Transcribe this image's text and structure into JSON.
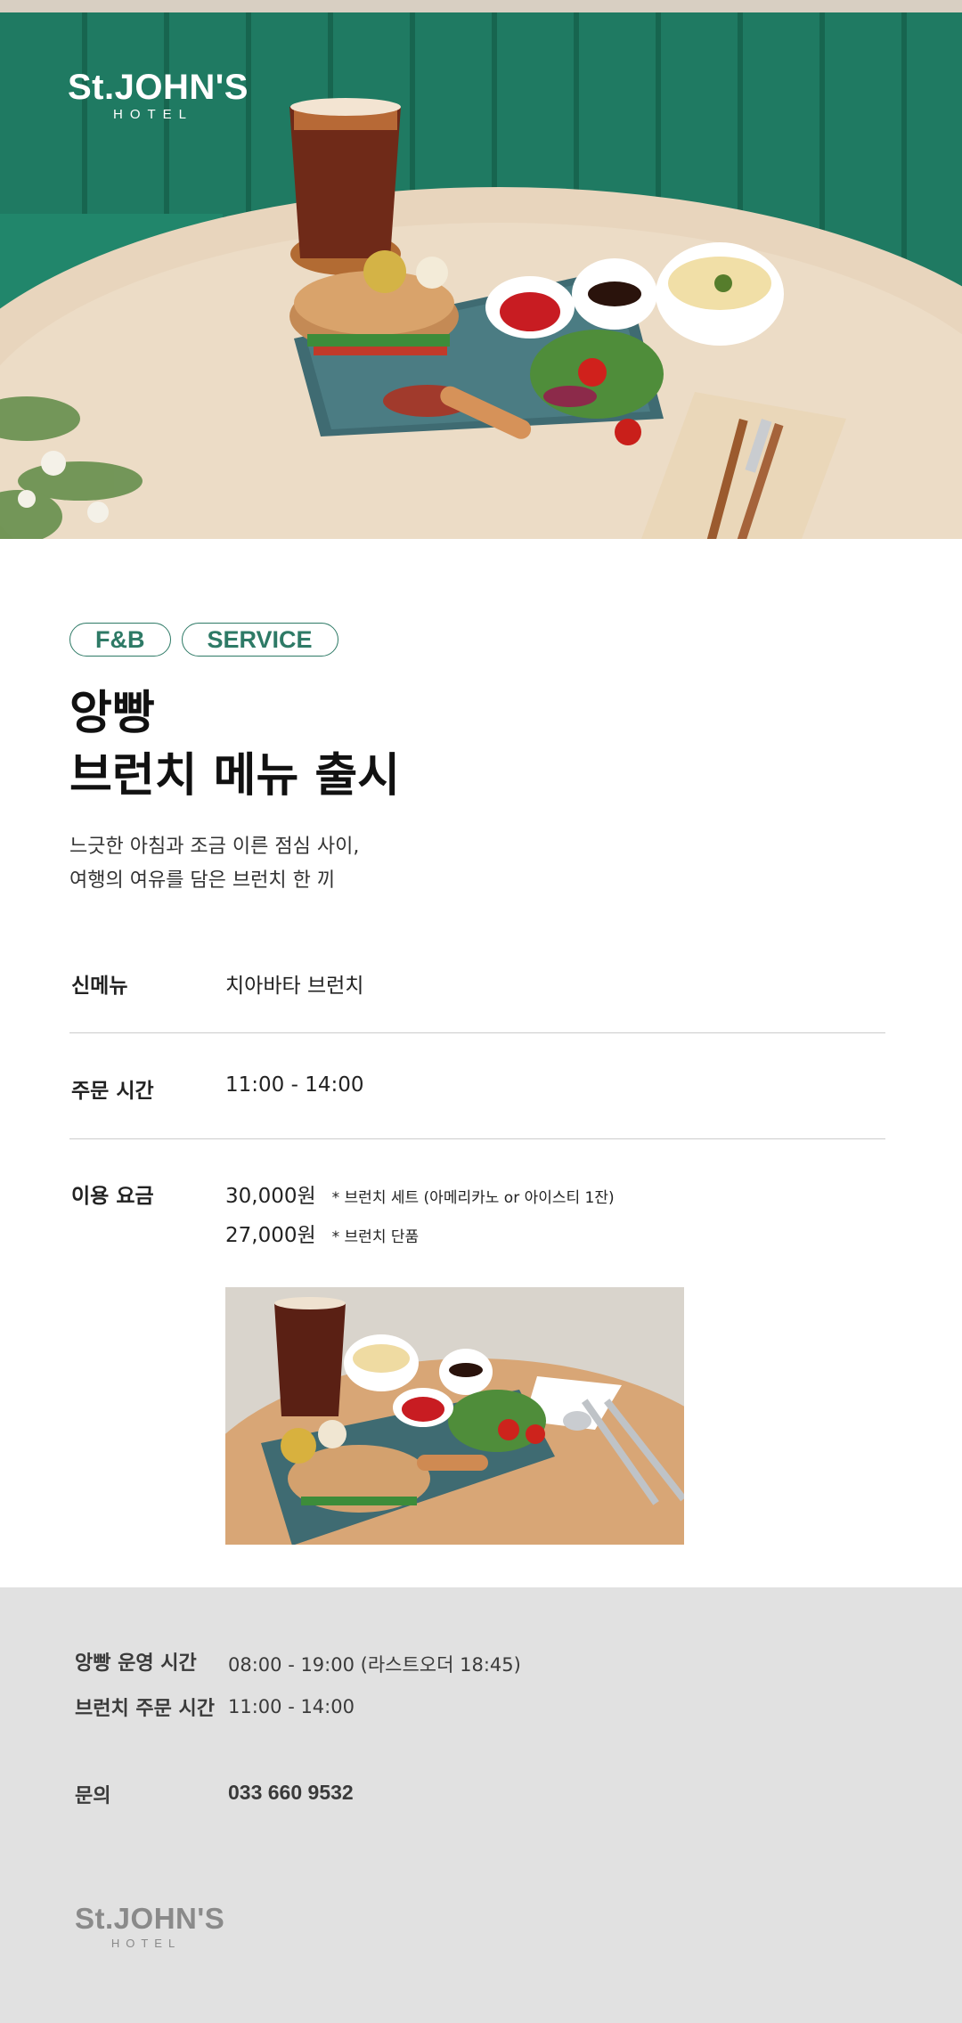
{
  "brand": {
    "name": "St.JOHN'S",
    "sub": "HOTEL"
  },
  "tags": [
    "F&B",
    "SERVICE"
  ],
  "headline": {
    "line1": "앙빵",
    "line2": "브런치 메뉴 출시"
  },
  "subtitle": {
    "line1": "느긋한 아침과 조금 이른 점심 사이,",
    "line2": "여행의 여유를 담은 브런치 한 끼"
  },
  "info": {
    "menu_label": "신메뉴",
    "menu_value": "치아바타 브런치",
    "time_label": "주문 시간",
    "time_value": "11:00 - 14:00",
    "price_label": "이용 요금",
    "prices": [
      {
        "amount": "30,000원",
        "note": "*  브런치 세트 (아메리카노 or 아이스티 1잔)"
      },
      {
        "amount": "27,000원",
        "note": "*  브런치 단품"
      }
    ]
  },
  "footer": {
    "hours_label": "앙빵 운영 시간",
    "hours_value": "08:00 - 19:00 (라스트오더 18:45)",
    "brunch_label": "브런치 주문 시간",
    "brunch_value": "11:00 - 14:00",
    "contact_label": "문의",
    "contact_value": "033 660 9532"
  },
  "colors": {
    "accent": "#2e7a66",
    "banquette": "#1e7a62",
    "footer_bg": "#e1e1e1"
  }
}
